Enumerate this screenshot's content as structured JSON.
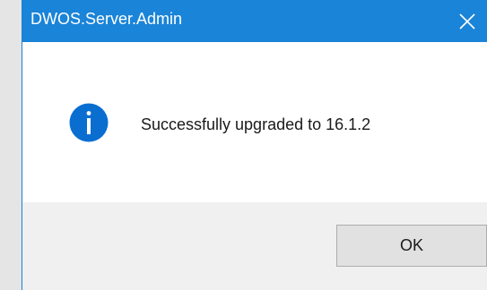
{
  "window": {
    "title": "DWOS.Server.Admin",
    "close_icon": "close-icon",
    "titlebar_color": "#1a84d8"
  },
  "message": {
    "icon": "info-icon",
    "icon_color": "#0a6ed1",
    "text": "Successfully upgraded to 16.1.2"
  },
  "buttons": {
    "ok_label": "OK"
  }
}
